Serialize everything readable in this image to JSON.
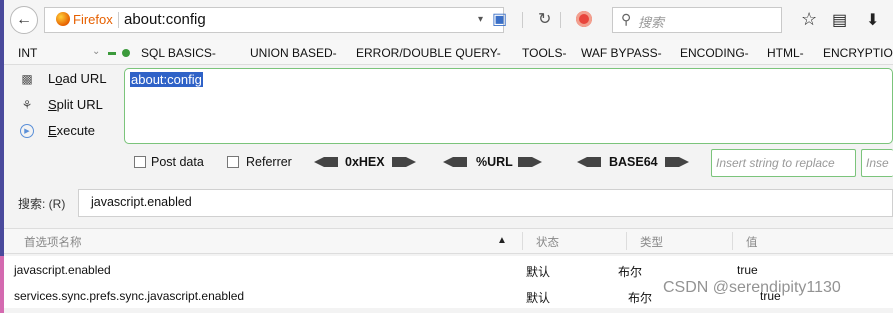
{
  "browser": {
    "brand": "Firefox",
    "url": "about:config",
    "search_placeholder": "搜索"
  },
  "icons": {
    "back": "back-arrow-icon",
    "firefox": "firefox-logo-icon",
    "reader": "reader-view-icon",
    "reload": "reload-icon",
    "block": "block-icon",
    "search": "search-icon",
    "bookmark": "star-icon",
    "library": "library-icon",
    "download": "download-icon"
  },
  "hackbar": {
    "select_value": "INT",
    "menu": [
      "SQL BASICS-",
      "UNION BASED-",
      "ERROR/DOUBLE QUERY-",
      "TOOLS-",
      "WAF BYPASS-",
      "ENCODING-",
      "HTML-",
      "ENCRYPTIO"
    ],
    "actions": {
      "load": {
        "prefix": "L",
        "underline": "o",
        "rest": "ad URL"
      },
      "split": {
        "prefix": "",
        "underline": "S",
        "rest": "plit URL"
      },
      "execute": {
        "prefix": "",
        "underline": "E",
        "rest": "xecute"
      }
    },
    "textarea_value": "about:config",
    "post_data_label": "Post data",
    "referrer_label": "Referrer",
    "hex_label": "0xHEX",
    "url_label": "%URL",
    "base64_label": "BASE64",
    "insert_placeholder_1": "Insert string to replace",
    "insert_placeholder_2": "Inse"
  },
  "config": {
    "search_label": "搜索: (R)",
    "search_value": "javascript.enabled",
    "columns": {
      "name": "首选项名称",
      "status": "状态",
      "type": "类型",
      "value": "值"
    },
    "rows": [
      {
        "name": "javascript.enabled",
        "status": "默认",
        "type": "布尔",
        "value": "true"
      },
      {
        "name": "services.sync.prefs.sync.javascript.enabled",
        "status": "默认",
        "type": "布尔",
        "value": "true"
      }
    ]
  },
  "watermark": "CSDN @serendipity1130",
  "colors": {
    "firefox_orange": "#e66000",
    "hackbar_green": "#7bc47b",
    "selection_blue": "#2f62c7"
  }
}
